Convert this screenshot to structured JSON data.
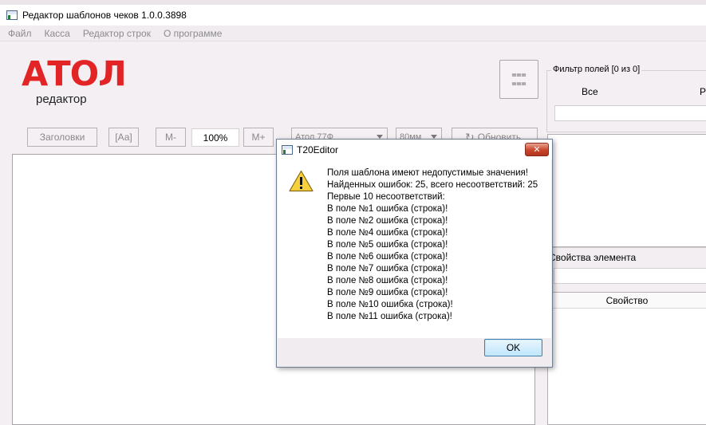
{
  "window": {
    "title": "Редактор шаблонов чеков 1.0.0.3898"
  },
  "menu": [
    "Файл",
    "Касса",
    "Редактор строк",
    "О программе"
  ],
  "logo": {
    "main": "АТОЛ",
    "sub": "редактор"
  },
  "toolbar": {
    "headers_label": "Заголовки",
    "font_label": "[Аа]",
    "zoom_out_label": "M-",
    "zoom_value": "100%",
    "zoom_in_label": "M+",
    "device_value": "Атол 77Ф",
    "width_value": "80мм",
    "refresh_label": "Обновить",
    "menu_icon_glyph": "===\n==="
  },
  "filter": {
    "title": "Фильтр полей [0 из 0]",
    "all_label": "Все",
    "r_label": "Р"
  },
  "properties": {
    "header": "Свойства элемента",
    "column_label": "Свойство"
  },
  "dialog": {
    "title": "T20Editor",
    "close_label": "✕",
    "lines": [
      "Поля шаблона имеют недопустимые значения!",
      "Найденных ошибок: 25, всего несоответствий: 25",
      "Первые 10 несоответствий:",
      "В поле №1 ошибка (строка)!",
      "В поле №2 ошибка (строка)!",
      "В поле №4 ошибка (строка)!",
      "В поле №5 ошибка (строка)!",
      "В поле №6 ошибка (строка)!",
      "В поле №7 ошибка (строка)!",
      "В поле №8 ошибка (строка)!",
      "В поле №9 ошибка (строка)!",
      "В поле №10 ошибка (строка)!",
      "В поле №11 ошибка (строка)!"
    ],
    "ok_label": "OK"
  },
  "colors": {
    "logo_red": "#e32427",
    "window_bg": "#f4eff2",
    "ok_border": "#3c7fb1",
    "close_red": "#c8462c"
  },
  "icons": {
    "app": "app-window-icon",
    "warning": "warning-triangle-icon",
    "refresh": "refresh-icon",
    "close": "close-icon"
  }
}
